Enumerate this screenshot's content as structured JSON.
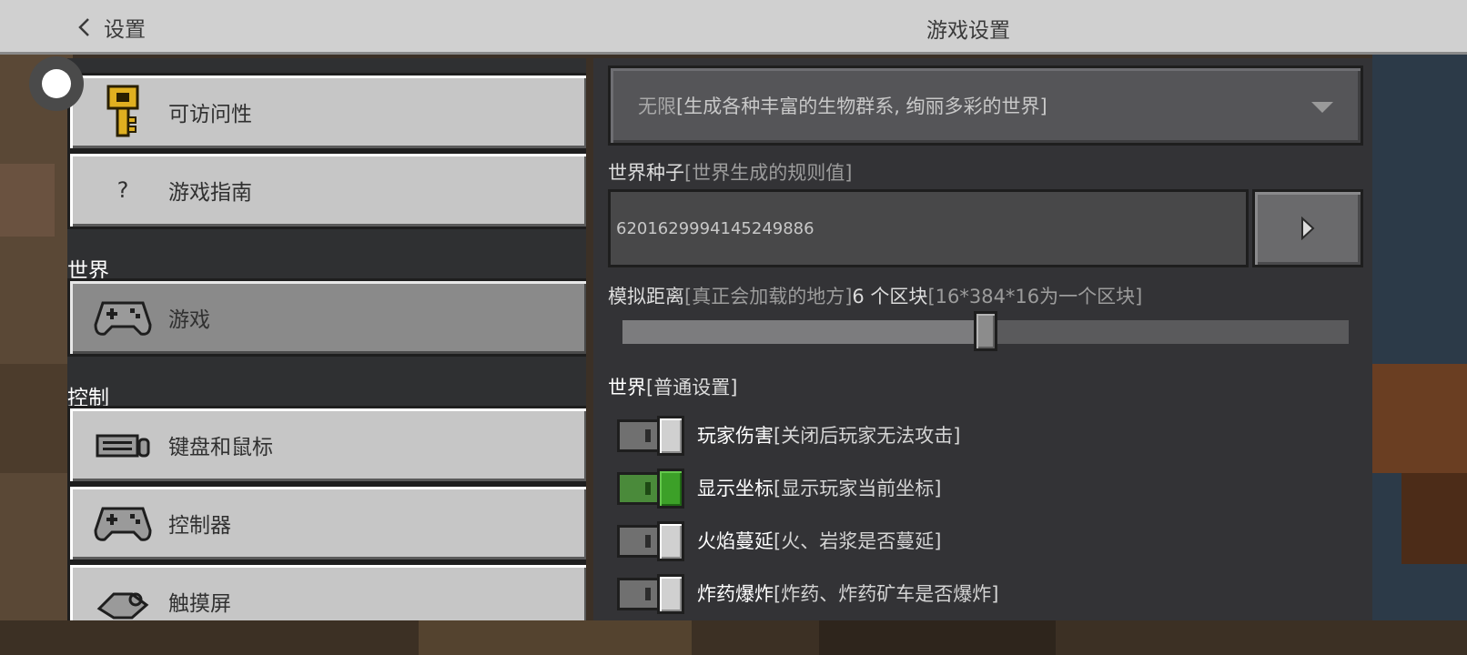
{
  "header": {
    "back_label": "设置",
    "title": "游戏设置"
  },
  "sidebar": {
    "items_top": [
      {
        "label": "可访问性",
        "icon": "key-icon"
      },
      {
        "label": "游戏指南",
        "icon": "question-icon",
        "glyph": "?"
      }
    ],
    "section_world": "世界",
    "world_items": [
      {
        "label": "游戏",
        "icon": "controller-icon",
        "selected": true
      }
    ],
    "section_controls": "控制",
    "control_items": [
      {
        "label": "键盘和鼠标",
        "icon": "keyboard-mouse-icon"
      },
      {
        "label": "控制器",
        "icon": "controller-icon"
      },
      {
        "label": "触摸屏",
        "icon": "touchscreen-icon"
      }
    ]
  },
  "settings": {
    "world_type": {
      "value": "无限",
      "hint": "[生成各种丰富的生物群系, 绚丽多彩的世界]"
    },
    "seed": {
      "label": "世界种子",
      "hint": "[世界生成的规则值]",
      "value": "6201629994145249886"
    },
    "sim_distance": {
      "label": "模拟距离",
      "hint": "[真正会加载的地方]",
      "value_text": "6 个区块",
      "hint2": "[16*384*16为一个区块]",
      "level": 0.5
    },
    "world_section": {
      "title": "世界",
      "hint": "[普通设置]"
    },
    "toggles": [
      {
        "label": "玩家伤害",
        "hint": "[关闭后玩家无法攻击]",
        "on": false
      },
      {
        "label": "显示坐标",
        "hint": "[显示玩家当前坐标]",
        "on": true
      },
      {
        "label": "火焰蔓延",
        "hint": "[火、岩浆是否蔓延]",
        "on": false
      },
      {
        "label": "炸药爆炸",
        "hint": "[炸药、炸药矿车是否爆炸]",
        "on": false
      }
    ]
  },
  "colors": {
    "toggle_on": "#3ca028",
    "panel": "#2f3032",
    "button": "#c6c6c6",
    "selected_button": "#8a8a8a"
  }
}
